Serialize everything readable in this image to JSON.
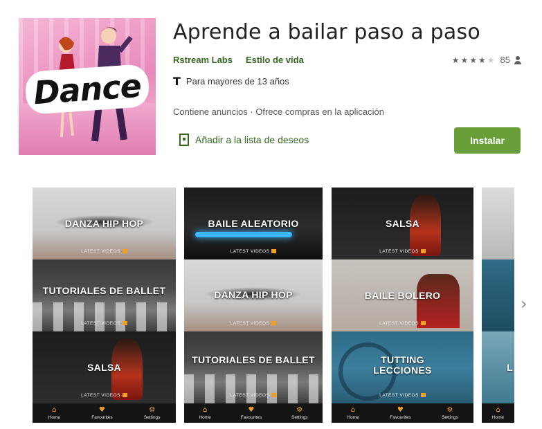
{
  "app": {
    "title": "Aprende a bailar paso a paso",
    "developer": "Rstream Labs",
    "category": "Estilo de vida",
    "rating_count": "85",
    "age_rating": "Para mayores de 13 años",
    "ads_note": "Contiene anuncios · Ofrece compras en la aplicación",
    "wishlist_label": "Añadir a la lista de deseos",
    "install_label": "Instalar",
    "icon_text": "Dance",
    "rating_stars": 3.5
  },
  "colors": {
    "accent": "#689f38",
    "link": "#33691e",
    "nav_accent": "#f0a020"
  },
  "screenshots": [
    {
      "tiles": [
        {
          "label": "DANZA HIP HOP",
          "sub": "LATEST VIDEOS"
        },
        {
          "label": "TUTORIALES DE BALLET",
          "sub": "LATEST VIDEOS"
        },
        {
          "label": "SALSA",
          "sub": "LATEST VIDEOS"
        }
      ]
    },
    {
      "tiles": [
        {
          "label": "BAILE ALEATORIO",
          "sub": "LATEST VIDEOS"
        },
        {
          "label": "DANZA HIP HOP",
          "sub": "LATEST VIDEOS"
        },
        {
          "label": "TUTORIALES DE BALLET",
          "sub": "LATEST VIDEOS"
        }
      ]
    },
    {
      "tiles": [
        {
          "label": "SALSA",
          "sub": "LATEST VIDEOS"
        },
        {
          "label": "BAILE BOLERO",
          "sub": "LATEST VIDEOS"
        },
        {
          "label": "TUTTING LECCIONES",
          "sub": "LATEST VIDEOS"
        }
      ]
    },
    {
      "tiles": [
        {
          "label": "",
          "sub": ""
        },
        {
          "label": "",
          "sub": ""
        },
        {
          "label": "L",
          "sub": ""
        }
      ]
    }
  ],
  "nav": {
    "home": "Home",
    "favourites": "Favourites",
    "settings": "Settings"
  },
  "icons": {
    "home": "home-icon",
    "favourites": "heart-icon",
    "settings": "gear-icon",
    "next": "chevron-right-icon",
    "wishlist": "bookmark-add-icon",
    "age": "teen-rating-icon",
    "user": "person-icon"
  }
}
